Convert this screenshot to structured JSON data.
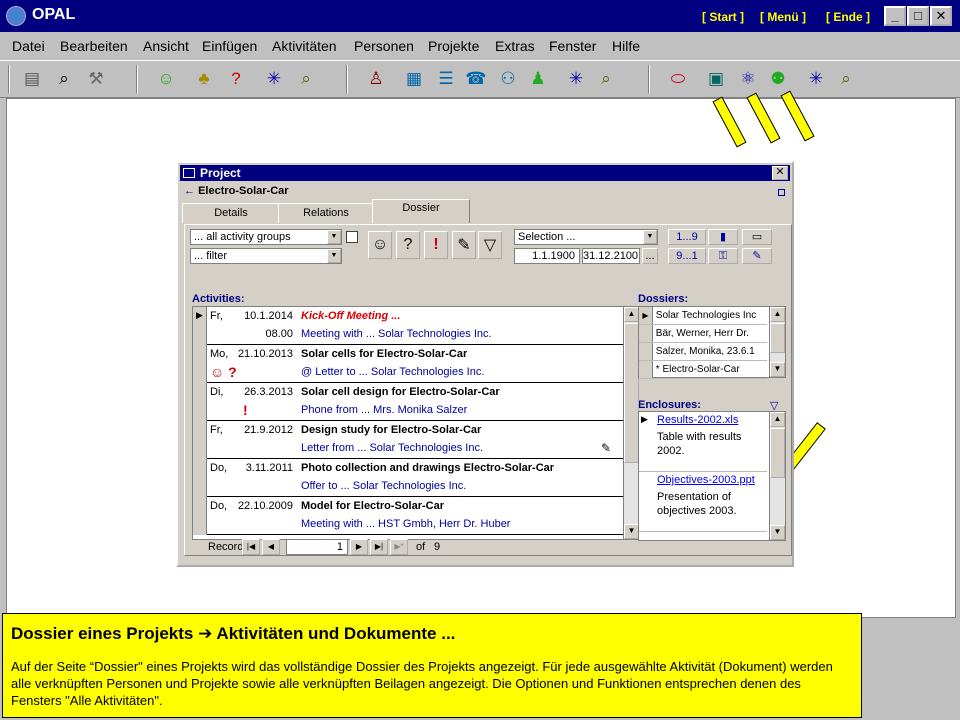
{
  "app": {
    "title": "OPAL",
    "nav_links": [
      "[ Start ]",
      "[ Menü ]",
      "[ Ende ]"
    ],
    "window_buttons": {
      "minimize": "_",
      "maximize": "□",
      "close": "✕"
    }
  },
  "menu": [
    "Datei",
    "Bearbeiten",
    "Ansicht",
    "Einfügen",
    "Aktivitäten",
    "Personen",
    "Projekte",
    "Extras",
    "Fenster",
    "Hilfe"
  ],
  "toolbar": {
    "icons": [
      {
        "name": "list-icon",
        "glyph": "▤"
      },
      {
        "name": "binoculars-icon",
        "glyph": "⌕"
      },
      {
        "name": "tools-icon",
        "glyph": "⚒"
      },
      {
        "name": "smiley-icon",
        "glyph": "☺"
      },
      {
        "name": "group-icon",
        "glyph": "♣"
      },
      {
        "name": "question-person-icon",
        "glyph": "?"
      },
      {
        "name": "new-person-icon",
        "glyph": "✳"
      },
      {
        "name": "person-search-icon",
        "glyph": "⌕"
      },
      {
        "name": "people-icon",
        "glyph": "♙"
      },
      {
        "name": "person-card-icon",
        "glyph": "▦"
      },
      {
        "name": "person-list-icon",
        "glyph": "☰"
      },
      {
        "name": "phone-icon",
        "glyph": "☎"
      },
      {
        "name": "persons-link-icon",
        "glyph": "⚇"
      },
      {
        "name": "persons-group-icon",
        "glyph": "♟"
      },
      {
        "name": "new-people-icon",
        "glyph": "✳"
      },
      {
        "name": "people-search-icon",
        "glyph": "⌕"
      },
      {
        "name": "pill-icon",
        "glyph": "⬭"
      },
      {
        "name": "project-card-icon",
        "glyph": "▣"
      },
      {
        "name": "project-network-icon",
        "glyph": "⚛"
      },
      {
        "name": "project-group-icon",
        "glyph": "⚉"
      },
      {
        "name": "new-project-icon",
        "glyph": "✳"
      },
      {
        "name": "project-search-icon",
        "glyph": "⌕"
      }
    ]
  },
  "project_window": {
    "title": "Project",
    "record_name": "Electro-Solar-Car",
    "tabs": [
      "Details",
      "Relations",
      "Dossier"
    ],
    "active_tab": "Dossier",
    "filters": {
      "group_select": "... all activity groups",
      "filter_select": "... filter",
      "selection_select": "Selection ...",
      "date_from": "1.1.1900",
      "date_to": "31.12.2100",
      "more_button": "...",
      "range1": "1...9",
      "range2": "9...1"
    },
    "activities_label": "Activities:",
    "dossiers_label": "Dossiers:",
    "enclosures_label": "Enclosures:",
    "activities": [
      {
        "day": "Fr,",
        "date": "10.1.2014",
        "time": "08.00",
        "title": "Kick-Off Meeting ...",
        "subtitle": "Meeting with ... Solar Technologies Inc.",
        "icons": ""
      },
      {
        "day": "Mo,",
        "date": "21.10.2013",
        "time": "",
        "title": "Solar cells for Electro-Solar-Car",
        "subtitle": "@ Letter to ... Solar Technologies Inc.",
        "icons": "☺ ?"
      },
      {
        "day": "Di,",
        "date": "26.3.2013",
        "time": "",
        "title": "Solar cell design for Electro-Solar-Car",
        "subtitle": "Phone from ... Mrs. Monika Salzer",
        "icons": "!"
      },
      {
        "day": "Fr,",
        "date": "21.9.2012",
        "time": "",
        "title": "Design study for Electro-Solar-Car",
        "subtitle": "Letter from ... Solar Technologies Inc.",
        "icons": ""
      },
      {
        "day": "Do,",
        "date": "3.11.2011",
        "time": "",
        "title": "Photo collection and drawings Electro-Solar-Car",
        "subtitle": "Offer to ... Solar Technologies Inc.",
        "icons": ""
      },
      {
        "day": "Do,",
        "date": "22.10.2009",
        "time": "",
        "title": "Model for Electro-Solar-Car",
        "subtitle": "Meeting with ... HST Gmbh, Herr Dr. Huber",
        "icons": ""
      }
    ],
    "dossiers": [
      "Solar Technologies Inc",
      "Bär, Werner, Herr Dr.",
      "Salzer, Monika, 23.6.1",
      "* Electro-Solar-Car"
    ],
    "enclosures": [
      {
        "file": "Results-2002.xls",
        "desc": "Table with results 2002."
      },
      {
        "file": "Objectives-2003.ppt",
        "desc": "Presentation of objectives 2003."
      }
    ],
    "record_nav": {
      "label": "Record:",
      "current": "1",
      "of_label": "of",
      "total": "9"
    }
  },
  "caption": {
    "title": "Dossier eines Projekts ➔ Aktivitäten und Dokumente ...",
    "body": "Auf der Seite “Dossier\" eines Projekts wird das vollständige Dossier des Projekts angezeigt. Für jede ausgewählte Aktivität (Dokument) werden alle verknüpften Personen und Projekte sowie alle verknüpften Beilagen angezeigt. Die Optionen und Funktionen entsprechen denen des Fensters \"Alle Aktivitäten\"."
  },
  "colors": {
    "titlebar": "#000080",
    "link_blue": "#0000a0",
    "caption_bg": "#ffff00",
    "kickoff_red": "#e00000"
  }
}
